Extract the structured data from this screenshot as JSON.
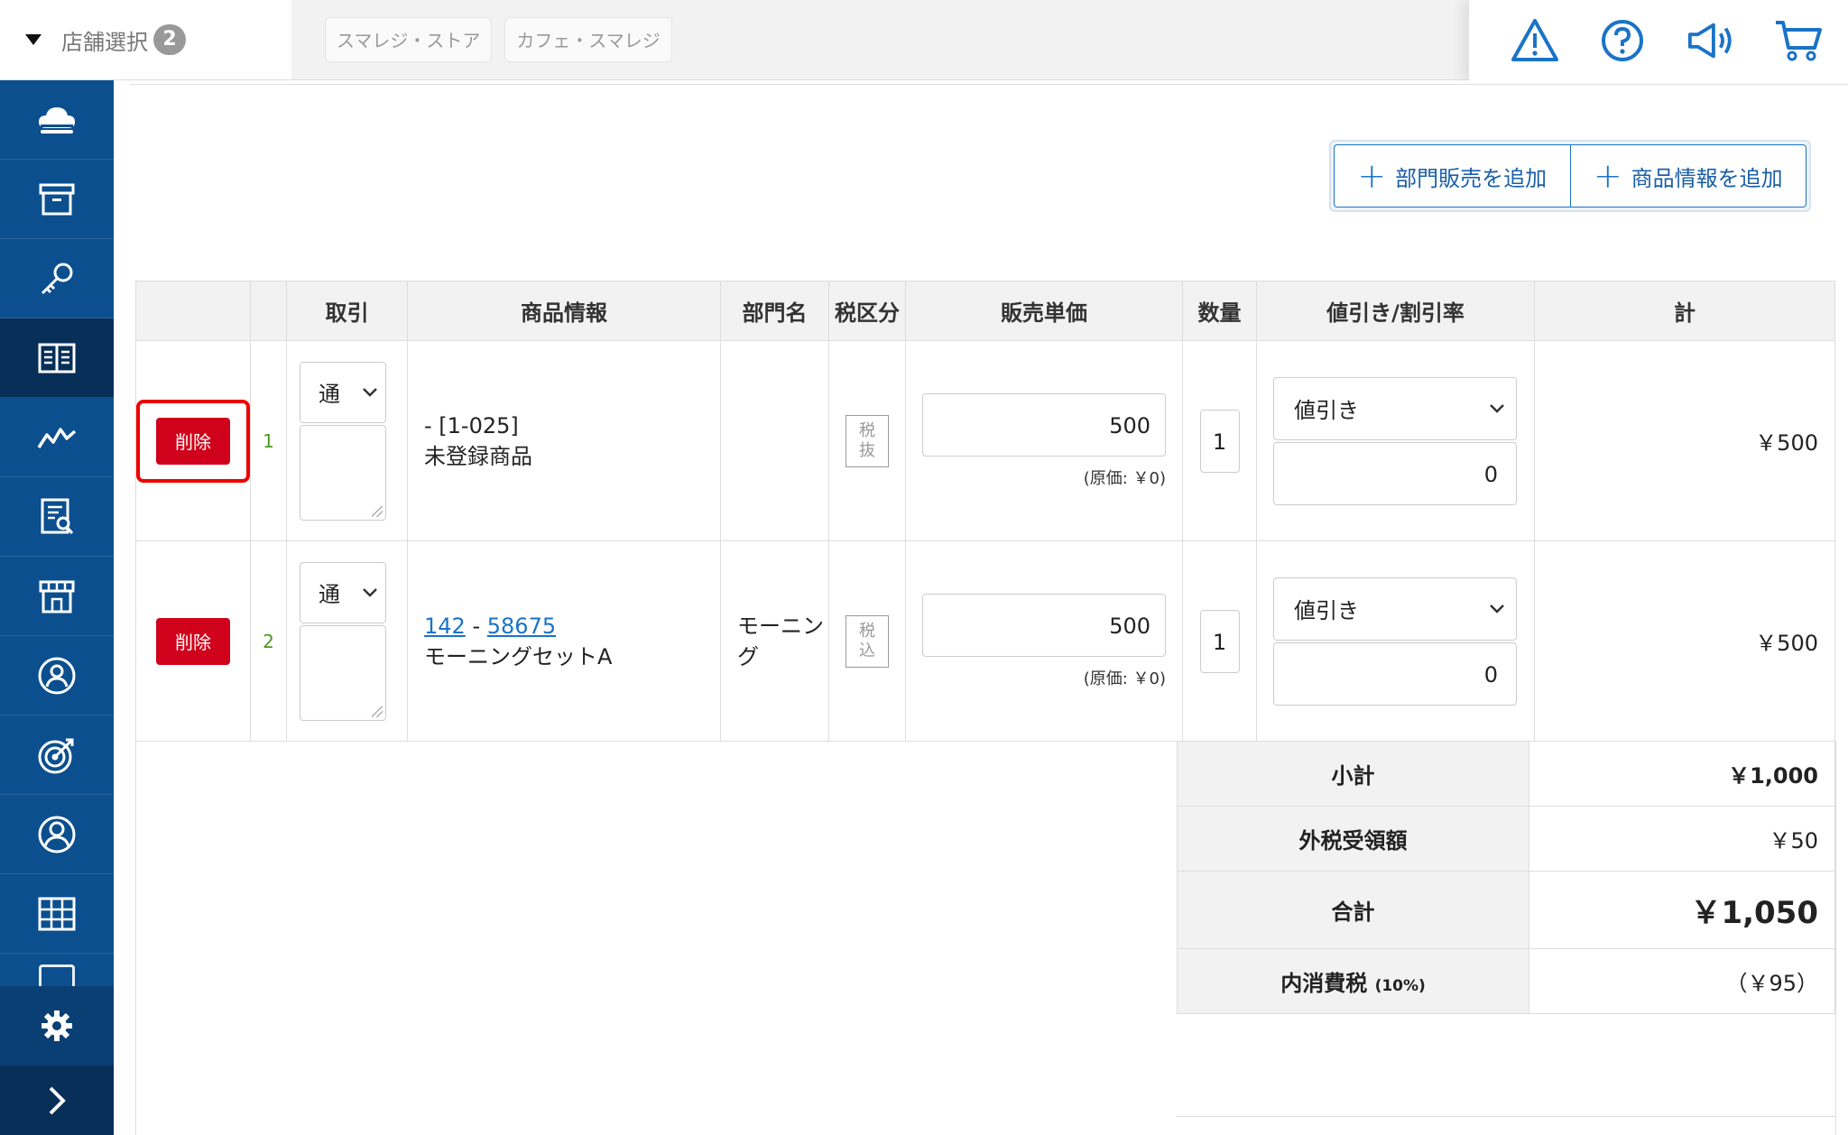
{
  "header": {
    "store_select_label": "店舗選択",
    "store_count": "2",
    "stores": [
      "スマレジ・ストア",
      "カフェ・スマレジ"
    ],
    "icons": [
      "warning-icon",
      "help-icon",
      "announcement-icon",
      "cart-icon"
    ]
  },
  "sidebar": {
    "items": [
      "cloud-icon",
      "archive-icon",
      "key-icon",
      "book-icon",
      "chart-icon",
      "report-icon",
      "store-icon",
      "customer-icon",
      "target-icon",
      "user-icon",
      "apps-icon"
    ],
    "active_index": 3,
    "bottom": [
      "gear-icon",
      "chevron-right-icon"
    ]
  },
  "actions": {
    "add_department_sale": "部門販売を追加",
    "add_product_info": "商品情報を追加"
  },
  "table": {
    "headers": {
      "transaction": "取引",
      "product_info": "商品情報",
      "department": "部門名",
      "tax_class": "税区分",
      "unit_price": "販売単価",
      "quantity": "数量",
      "discount": "値引き/割引率",
      "total": "計"
    },
    "rows": [
      {
        "delete_label": "削除",
        "no": "1",
        "transaction_type": "通",
        "product_code_text": "- [1-025]",
        "product_name": "未登録商品",
        "department": "",
        "tax_class_line1": "税",
        "tax_class_line2": "抜",
        "price": "500",
        "cost": "(原価: ￥0)",
        "quantity": "1",
        "discount_type": "値引き",
        "discount_value": "0",
        "total": "￥500"
      },
      {
        "delete_label": "削除",
        "no": "2",
        "transaction_type": "通",
        "product_id": "142",
        "separator": "-",
        "product_code": "58675",
        "product_name": "モーニングセットA",
        "department": "モーニング",
        "tax_class_line1": "税",
        "tax_class_line2": "込",
        "price": "500",
        "cost": "(原価: ￥0)",
        "quantity": "1",
        "discount_type": "値引き",
        "discount_value": "0",
        "total": "￥500"
      }
    ]
  },
  "summary": {
    "subtotal_label": "小計",
    "subtotal": "￥1,000",
    "external_tax_label": "外税受領額",
    "external_tax": "￥50",
    "total_label": "合計",
    "total": "￥1,050",
    "internal_tax_label": "内消費税",
    "internal_tax_rate": "(10%)",
    "internal_tax": "（￥95）"
  },
  "colors": {
    "sidebar": "#0b4f8e",
    "sidebar_active": "#072f57",
    "delete": "#d0021b",
    "link": "#1a73c8",
    "highlight": "#e00000"
  }
}
